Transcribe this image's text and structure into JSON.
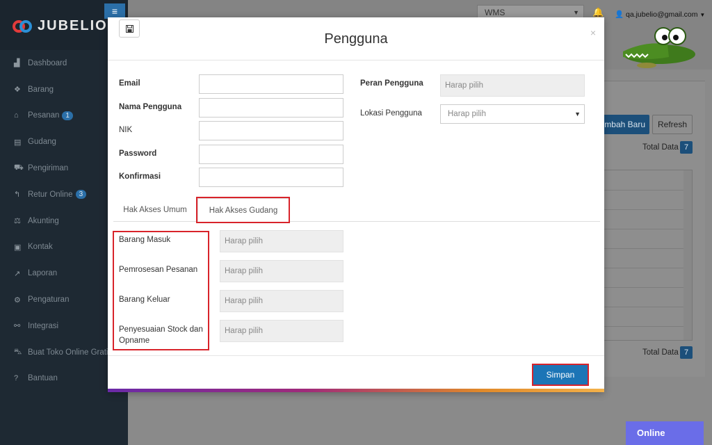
{
  "sidebar": {
    "logo_text": "JUBELIO",
    "menu": [
      {
        "label": "Dashboard",
        "icon": "dashboard-icon",
        "glyph": "▟",
        "badge": ""
      },
      {
        "label": "Barang",
        "icon": "cubes-icon",
        "glyph": "❖",
        "badge": ""
      },
      {
        "label": "Pesanan",
        "icon": "basket-icon",
        "glyph": "⌂",
        "badge": "1"
      },
      {
        "label": "Gudang",
        "icon": "building-icon",
        "glyph": "▤",
        "badge": ""
      },
      {
        "label": "Pengiriman",
        "icon": "truck-icon",
        "glyph": "⛟",
        "badge": ""
      },
      {
        "label": "Retur Online",
        "icon": "reply-icon",
        "glyph": "↰",
        "badge": "3"
      },
      {
        "label": "Akunting",
        "icon": "balance-scale-icon",
        "glyph": "⚖",
        "badge": ""
      },
      {
        "label": "Kontak",
        "icon": "address-card-icon",
        "glyph": "▣",
        "badge": ""
      },
      {
        "label": "Laporan",
        "icon": "chart-line-icon",
        "glyph": "↗",
        "badge": ""
      },
      {
        "label": "Pengaturan",
        "icon": "cogs-icon",
        "glyph": "⚙",
        "badge": ""
      },
      {
        "label": "Integrasi",
        "icon": "sitemap-icon",
        "glyph": "⚯",
        "badge": ""
      },
      {
        "label": "Buat Toko Online Gratis",
        "icon": "shopping-cart-icon",
        "glyph": "⛍",
        "badge": ""
      },
      {
        "label": "Bantuan",
        "icon": "question-circle-icon",
        "glyph": "?",
        "badge": ""
      }
    ]
  },
  "topbar": {
    "location_select": "WMS",
    "user_email": "qa.jubelio@gmail.com"
  },
  "background": {
    "add_button": "mbah Baru",
    "refresh_button": "Refresh",
    "total_label": "Total Data",
    "total_value": "7",
    "online_button": "Online"
  },
  "modal": {
    "title": "Pengguna",
    "close": "×",
    "fields": {
      "email_label": "Email",
      "username_label": "Nama Pengguna",
      "nik_label": "NIK",
      "password_label": "Password",
      "confirm_label": "Konfirmasi",
      "email_value": "",
      "username_value": "",
      "nik_value": "",
      "password_value": "",
      "confirm_value": ""
    },
    "role_label": "Peran Pengguna",
    "role_value": "Harap pilih",
    "location_label": "Lokasi Pengguna",
    "location_value": "Harap pilih",
    "tabs": {
      "general": "Hak Akses Umum",
      "warehouse": "Hak Akses Gudang",
      "active": "warehouse"
    },
    "permissions": [
      {
        "label": "Barang Masuk",
        "value": "Harap pilih"
      },
      {
        "label": "Pemrosesan Pesanan",
        "value": "Harap pilih"
      },
      {
        "label": "Barang Keluar",
        "value": "Harap pilih"
      },
      {
        "label": "Penyesuaian Stock dan Opname",
        "value": "Harap pilih"
      }
    ],
    "save_button": "Simpan"
  },
  "colors": {
    "primary": "#1c75b6",
    "highlight": "#d8232a",
    "sidebar": "#1e2933"
  }
}
